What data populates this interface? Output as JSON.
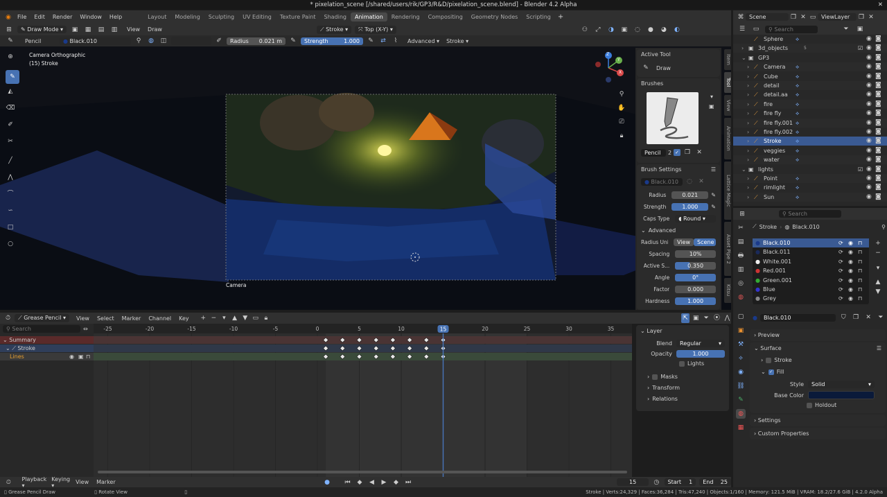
{
  "title_bar": {
    "title": "* pixelation_scene [/shared/users/rik/GP3/R&D/pixelation_scene.blend] - Blender 4.2 Alpha"
  },
  "menu": [
    "File",
    "Edit",
    "Render",
    "Window",
    "Help"
  ],
  "workspaces": [
    "Layout",
    "Modeling",
    "Sculpting",
    "UV Editing",
    "Texture Paint",
    "Shading",
    "Animation",
    "Rendering",
    "Compositing",
    "Geometry Nodes",
    "Scripting"
  ],
  "active_workspace": "Animation",
  "scene": {
    "label": "Scene",
    "view_layer": "ViewLayer"
  },
  "viewport_header": {
    "mode": "Draw Mode",
    "view": "View",
    "draw": "Draw",
    "stroke": "Stroke",
    "orientation": "Top (X-Y)"
  },
  "tool_header": {
    "tool": "Pencil",
    "material": "Black.010",
    "radius_label": "Radius",
    "radius_value": "0.021 m",
    "strength_label": "Strength",
    "strength_value": "1.000",
    "advanced": "Advanced",
    "stroke": "Stroke"
  },
  "viewport": {
    "camera_info": "Camera Orthographic",
    "object_info": "(15) Stroke",
    "camera_label": "Camera",
    "axes": {
      "z": "Z",
      "x": "X",
      "y": "Y"
    }
  },
  "sidebar": {
    "active_tool_header": "Active Tool",
    "tool_name": "Draw",
    "brushes_header": "Brushes",
    "brush_name": "Pencil",
    "brush_users": "2",
    "brush_settings_header": "Brush Settings",
    "brush_material": "Black.010",
    "radius_label": "Radius",
    "radius_value": "0.021",
    "strength_label": "Strength",
    "strength_value": "1.000",
    "caps_label": "Caps Type",
    "caps_value": "Round",
    "advanced_header": "Advanced",
    "radius_unit_label": "Radius Unit",
    "radius_unit_view": "View",
    "radius_unit_scene": "Scene",
    "spacing_label": "Spacing",
    "spacing_value": "10%",
    "active_s_label": "Active S...",
    "active_s_value": "0.350",
    "active_s_fill": 0.35,
    "angle_label": "Angle",
    "angle_value": "0°",
    "factor_label": "Factor",
    "factor_value": "0.000",
    "hardness_label": "Hardness",
    "hardness_value": "1.000",
    "tabs": [
      "Item",
      "Tool",
      "View",
      "Animation",
      "Lattice Magic",
      "Asset Pipe 2",
      "Kitsu"
    ]
  },
  "outliner": {
    "search_placeholder": "Search",
    "items": [
      {
        "name": "Sphere",
        "indent": 2
      },
      {
        "name": "3d_objects",
        "indent": 1,
        "count": "5"
      },
      {
        "name": "GP3",
        "indent": 1
      },
      {
        "name": "Camera",
        "indent": 2
      },
      {
        "name": "Cube",
        "indent": 2
      },
      {
        "name": "detail",
        "indent": 2
      },
      {
        "name": "detail.aa",
        "indent": 2
      },
      {
        "name": "fire",
        "indent": 2
      },
      {
        "name": "fire fly",
        "indent": 2
      },
      {
        "name": "fire fly.001",
        "indent": 2
      },
      {
        "name": "fire fly.002",
        "indent": 2
      },
      {
        "name": "Stroke",
        "indent": 2,
        "selected": true
      },
      {
        "name": "veggies",
        "indent": 2
      },
      {
        "name": "water",
        "indent": 2
      },
      {
        "name": "lights",
        "indent": 1
      },
      {
        "name": "Point",
        "indent": 2
      },
      {
        "name": "rimlight",
        "indent": 2
      },
      {
        "name": "Sun",
        "indent": 2
      }
    ]
  },
  "properties": {
    "search_placeholder": "Search",
    "breadcrumb_object": "Stroke",
    "breadcrumb_material": "Black.010",
    "materials": [
      "Black.010",
      "Black.011",
      "White.001",
      "Red.001",
      "Green.001",
      "Blue",
      "Grey"
    ],
    "active_material": "Black.010",
    "material_field": "Black.010",
    "preview": "Preview",
    "surface": "Surface",
    "stroke": "Stroke",
    "fill": "Fill",
    "style_label": "Style",
    "style_value": "Solid",
    "base_color_label": "Base Color",
    "base_color": "#0a1a3a",
    "holdout": "Holdout",
    "settings": "Settings",
    "custom_properties": "Custom Properties"
  },
  "dopesheet": {
    "mode": "Grease Pencil",
    "menus": [
      "View",
      "Select",
      "Marker",
      "Channel",
      "Key"
    ],
    "search_placeholder": "Search",
    "channels": [
      {
        "name": "Summary"
      },
      {
        "name": "Stroke"
      },
      {
        "name": "Lines"
      }
    ],
    "ticks": [
      "-25",
      "-20",
      "-15",
      "-10",
      "-5",
      "0",
      "5",
      "10",
      "15",
      "20",
      "25",
      "30",
      "35"
    ],
    "current_frame": "15",
    "keyframes": [
      1,
      3,
      5,
      7,
      9,
      11,
      13,
      15
    ]
  },
  "layer_panel": {
    "header": "Layer",
    "blend_label": "Blend",
    "blend_value": "Regular",
    "opacity_label": "Opacity",
    "opacity_value": "1.000",
    "lights": "Lights",
    "masks": "Masks",
    "transform": "Transform",
    "relations": "Relations"
  },
  "timeline": {
    "playback": "Playback",
    "keying": "Keying",
    "view": "View",
    "marker": "Marker",
    "frame": "15",
    "start_label": "Start",
    "start": "1",
    "end_label": "End",
    "end": "25"
  },
  "status_bar": {
    "left1": "Grease Pencil Draw",
    "left2": "Rotate View",
    "right": "Stroke | Verts:24,329 | Faces:36,284 | Tris:47,240 | Objects:1/160 | Memory: 121.5 MiB | VRAM: 18.2/27.6 GiB | 4.2.0 Alpha"
  },
  "colors": {
    "accent": "#4772b3",
    "workspace_active": "#4a4a4a",
    "playhead": "#4772b3"
  }
}
